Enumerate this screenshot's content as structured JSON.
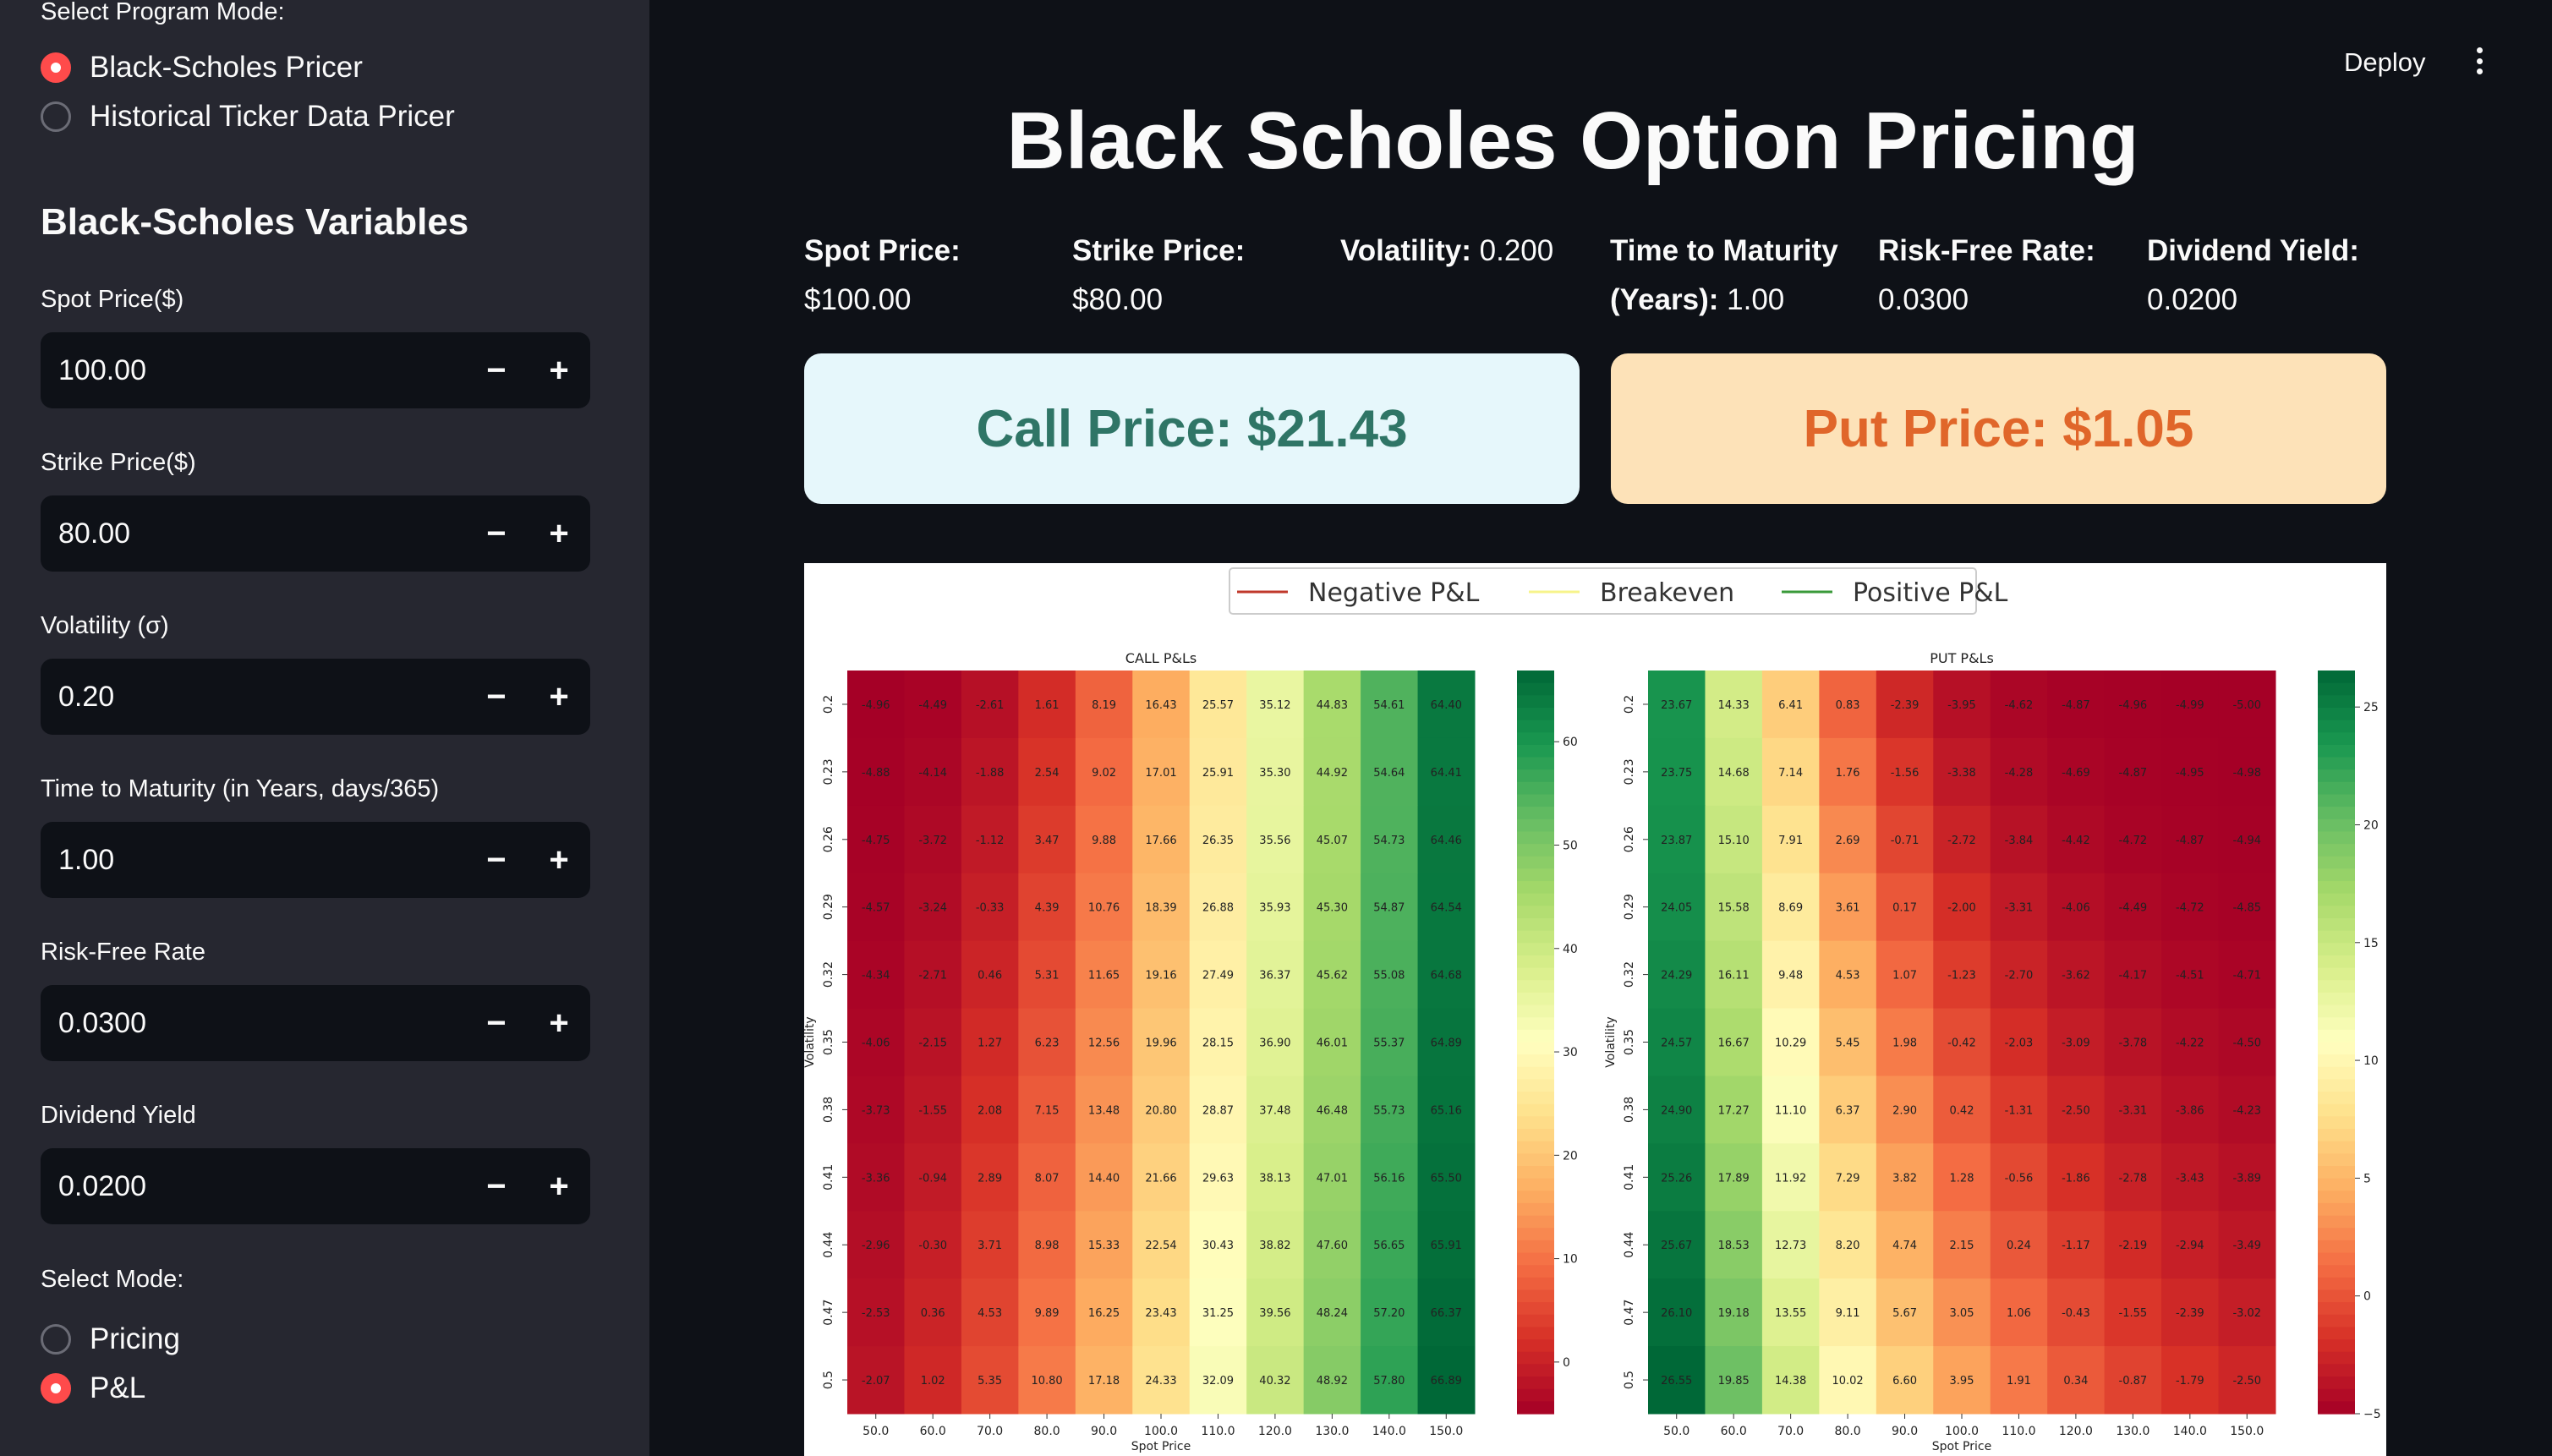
{
  "sidebar": {
    "program_mode_label": "Select Program Mode:",
    "program_modes": [
      {
        "label": "Black-Scholes Pricer",
        "selected": true
      },
      {
        "label": "Historical Ticker Data Pricer",
        "selected": false
      }
    ],
    "section_title": "Black-Scholes Variables",
    "inputs": [
      {
        "label": "Spot Price($)",
        "value": "100.00"
      },
      {
        "label": "Strike Price($)",
        "value": "80.00"
      },
      {
        "label": "Volatility (σ)",
        "value": "0.20"
      },
      {
        "label": "Time to Maturity (in Years, days/365)",
        "value": "1.00"
      },
      {
        "label": "Risk-Free Rate",
        "value": "0.0300"
      },
      {
        "label": "Dividend Yield",
        "value": "0.0200"
      }
    ],
    "stepper_minus": "−",
    "stepper_plus": "+",
    "mode_label": "Select Mode:",
    "modes": [
      {
        "label": "Pricing",
        "selected": false
      },
      {
        "label": "P&L",
        "selected": true
      }
    ]
  },
  "header": {
    "deploy_label": "Deploy",
    "menu_icon": "kebab-menu-icon"
  },
  "main": {
    "title": "Black Scholes Option Pricing",
    "metrics": [
      {
        "label": "Spot Price:",
        "value": "$100.00"
      },
      {
        "label": "Strike Price:",
        "value": "$80.00"
      },
      {
        "label": "Volatility:",
        "value": "0.200"
      },
      {
        "label": "Time to Maturity (Years):",
        "value": "1.00"
      },
      {
        "label": "Risk-Free Rate:",
        "value": "0.0300"
      },
      {
        "label": "Dividend Yield:",
        "value": "0.0200"
      }
    ],
    "call_price": "Call Price: $21.43",
    "put_price": "Put Price: $1.05"
  },
  "colors": {
    "accent": "#ff4b4b",
    "call_bg": "#e6f7fb",
    "call_text": "#2f7566",
    "put_bg": "#fde2b8",
    "put_text": "#e0662a",
    "negative_line": "#c0392b",
    "breakeven_line": "#f7f48b",
    "positive_line": "#3a9a3a"
  },
  "chart_data": [
    {
      "type": "heatmap",
      "title": "CALL P&Ls",
      "xlabel": "Spot Price",
      "ylabel": "Volatility",
      "legend": [
        "Negative P&L",
        "Breakeven",
        "Positive P&L"
      ],
      "legend_position": "top-center",
      "x": [
        "50.0",
        "60.0",
        "70.0",
        "80.0",
        "90.0",
        "100.0",
        "110.0",
        "120.0",
        "130.0",
        "140.0",
        "150.0"
      ],
      "y": [
        "0.2",
        "0.23",
        "0.26",
        "0.29",
        "0.32",
        "0.35",
        "0.38",
        "0.41",
        "0.44",
        "0.47",
        "0.5"
      ],
      "colorbar_ticks": [
        "0",
        "10",
        "20",
        "30",
        "40",
        "50",
        "60"
      ],
      "zlim": [
        -5,
        66.89
      ],
      "values": [
        [
          -4.96,
          -4.49,
          -2.61,
          1.61,
          8.19,
          16.43,
          25.57,
          35.12,
          44.83,
          54.61,
          64.4
        ],
        [
          -4.88,
          -4.14,
          -1.88,
          2.54,
          9.02,
          17.01,
          25.91,
          35.3,
          44.92,
          54.64,
          64.41
        ],
        [
          -4.75,
          -3.72,
          -1.12,
          3.47,
          9.88,
          17.66,
          26.35,
          35.56,
          45.07,
          54.73,
          64.46
        ],
        [
          -4.57,
          -3.24,
          -0.33,
          4.39,
          10.76,
          18.39,
          26.88,
          35.93,
          45.3,
          54.87,
          64.54
        ],
        [
          -4.34,
          -2.71,
          0.46,
          5.31,
          11.65,
          19.16,
          27.49,
          36.37,
          45.62,
          55.08,
          64.68
        ],
        [
          -4.06,
          -2.15,
          1.27,
          6.23,
          12.56,
          19.96,
          28.15,
          36.9,
          46.01,
          55.37,
          64.89
        ],
        [
          -3.73,
          -1.55,
          2.08,
          7.15,
          13.48,
          20.8,
          28.87,
          37.48,
          46.48,
          55.73,
          65.16
        ],
        [
          -3.36,
          -0.94,
          2.89,
          8.07,
          14.4,
          21.66,
          29.63,
          38.13,
          47.01,
          56.16,
          65.5
        ],
        [
          -2.96,
          -0.3,
          3.71,
          8.98,
          15.33,
          22.54,
          30.43,
          38.82,
          47.6,
          56.65,
          65.91
        ],
        [
          -2.53,
          0.36,
          4.53,
          9.89,
          16.25,
          23.43,
          31.25,
          39.56,
          48.24,
          57.2,
          66.37
        ],
        [
          -2.07,
          1.02,
          5.35,
          10.8,
          17.18,
          24.33,
          32.09,
          40.32,
          48.92,
          57.8,
          66.89
        ]
      ]
    },
    {
      "type": "heatmap",
      "title": "PUT P&Ls",
      "xlabel": "Spot Price",
      "ylabel": "Volatility",
      "x": [
        "50.0",
        "60.0",
        "70.0",
        "80.0",
        "90.0",
        "100.0",
        "110.0",
        "120.0",
        "130.0",
        "140.0",
        "150.0"
      ],
      "y": [
        "0.2",
        "0.23",
        "0.26",
        "0.29",
        "0.32",
        "0.35",
        "0.38",
        "0.41",
        "0.44",
        "0.47",
        "0.5"
      ],
      "colorbar_ticks": [
        "−5",
        "0",
        "5",
        "10",
        "15",
        "20",
        "25"
      ],
      "zlim": [
        -5,
        26.55
      ],
      "values": [
        [
          23.67,
          14.33,
          6.41,
          0.83,
          -2.39,
          -3.95,
          -4.62,
          -4.87,
          -4.96,
          -4.99,
          -5.0
        ],
        [
          23.75,
          14.68,
          7.14,
          1.76,
          -1.56,
          -3.38,
          -4.28,
          -4.69,
          -4.87,
          -4.95,
          -4.98
        ],
        [
          23.87,
          15.1,
          7.91,
          2.69,
          -0.71,
          -2.72,
          -3.84,
          -4.42,
          -4.72,
          -4.87,
          -4.94
        ],
        [
          24.05,
          15.58,
          8.69,
          3.61,
          0.17,
          -2.0,
          -3.31,
          -4.06,
          -4.49,
          -4.72,
          -4.85
        ],
        [
          24.29,
          16.11,
          9.48,
          4.53,
          1.07,
          -1.23,
          -2.7,
          -3.62,
          -4.17,
          -4.51,
          -4.71
        ],
        [
          24.57,
          16.67,
          10.29,
          5.45,
          1.98,
          -0.42,
          -2.03,
          -3.09,
          -3.78,
          -4.22,
          -4.5
        ],
        [
          24.9,
          17.27,
          11.1,
          6.37,
          2.9,
          0.42,
          -1.31,
          -2.5,
          -3.31,
          -3.86,
          -4.23
        ],
        [
          25.26,
          17.89,
          11.92,
          7.29,
          3.82,
          1.28,
          -0.56,
          -1.86,
          -2.78,
          -3.43,
          -3.89
        ],
        [
          25.67,
          18.53,
          12.73,
          8.2,
          4.74,
          2.15,
          0.24,
          -1.17,
          -2.19,
          -2.94,
          -3.49
        ],
        [
          26.1,
          19.18,
          13.55,
          9.11,
          5.67,
          3.05,
          1.06,
          -0.43,
          -1.55,
          -2.39,
          -3.02
        ],
        [
          26.55,
          19.85,
          14.38,
          10.02,
          6.6,
          3.95,
          1.91,
          0.34,
          -0.87,
          -1.79,
          -2.5
        ]
      ]
    }
  ]
}
